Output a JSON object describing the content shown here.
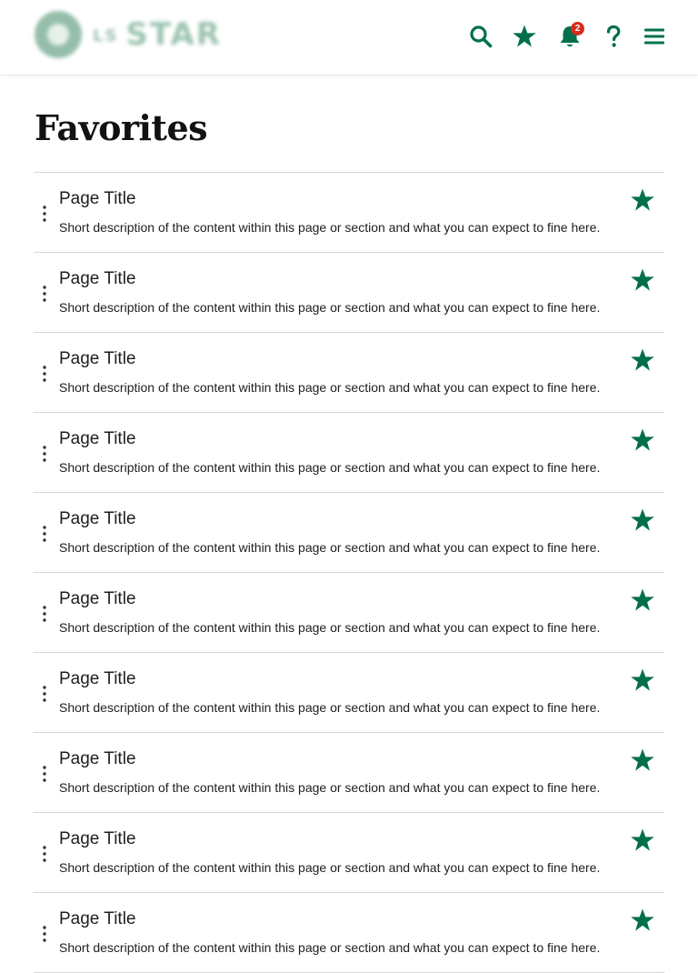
{
  "brand": {
    "name": "STAR",
    "lead": "LS",
    "accent_color": "#00704a",
    "badge_color": "#d62b1e"
  },
  "header": {
    "icons": [
      {
        "name": "search-icon"
      },
      {
        "name": "favorites-star-icon"
      },
      {
        "name": "notifications-bell-icon"
      },
      {
        "name": "help-question-icon"
      },
      {
        "name": "menu-hamburger-icon"
      }
    ],
    "notification_count": "2"
  },
  "page": {
    "title": "Favorites"
  },
  "favorites": [
    {
      "title": "Page Title",
      "description": "Short description of the content within this page or section and what you can expect to fine here."
    },
    {
      "title": "Page Title",
      "description": "Short description of the content within this page or section and what you can expect to fine here."
    },
    {
      "title": "Page Title",
      "description": "Short description of the content within this page or section and what you can expect to fine here."
    },
    {
      "title": "Page Title",
      "description": "Short description of the content within this page or section and what you can expect to fine here."
    },
    {
      "title": "Page Title",
      "description": "Short description of the content within this page or section and what you can expect to fine here."
    },
    {
      "title": "Page Title",
      "description": "Short description of the content within this page or section and what you can expect to fine here."
    },
    {
      "title": "Page Title",
      "description": "Short description of the content within this page or section and what you can expect to fine here."
    },
    {
      "title": "Page Title",
      "description": "Short description of the content within this page or section and what you can expect to fine here."
    },
    {
      "title": "Page Title",
      "description": "Short description of the content within this page or section and what you can expect to fine here."
    },
    {
      "title": "Page Title",
      "description": "Short description of the content within this page or section and what you can expect to fine here."
    }
  ],
  "row_icons": {
    "more": "more-vertical-icon",
    "star": "star-filled-icon"
  }
}
